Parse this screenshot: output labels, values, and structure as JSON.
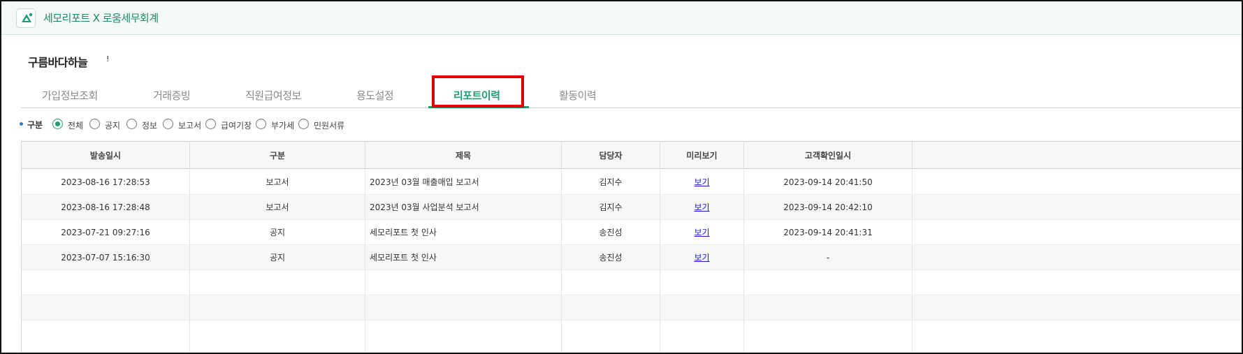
{
  "app": {
    "title": "세모리포트 X 로움세무회계",
    "logo_icon": "semo-logo-icon",
    "accent_color": "#1e9c76"
  },
  "company": {
    "name": "구름바다하늘",
    "mark": "!"
  },
  "tabs": [
    {
      "label": "가입정보조회",
      "active": false
    },
    {
      "label": "거래증빙",
      "active": false
    },
    {
      "label": "직원급여정보",
      "active": false
    },
    {
      "label": "용도설정",
      "active": false
    },
    {
      "label": "리포트이력",
      "active": true
    },
    {
      "label": "활동이력",
      "active": false
    }
  ],
  "filter": {
    "label": "구분",
    "options": [
      {
        "label": "전체",
        "selected": true
      },
      {
        "label": "공지",
        "selected": false
      },
      {
        "label": "정보",
        "selected": false
      },
      {
        "label": "보고서",
        "selected": false
      },
      {
        "label": "급여기장",
        "selected": false
      },
      {
        "label": "부가세",
        "selected": false
      },
      {
        "label": "민원서류",
        "selected": false
      }
    ]
  },
  "table": {
    "columns": [
      "발송일시",
      "구분",
      "제목",
      "담당자",
      "미리보기",
      "고객확인일시",
      ""
    ],
    "rows": [
      {
        "sent": "2023-08-16 17:28:53",
        "category": "보고서",
        "title": "2023년 03월 매출매입 보고서",
        "manager": "김지수",
        "preview": "보기",
        "confirmed": "2023-09-14 20:41:50"
      },
      {
        "sent": "2023-08-16 17:28:48",
        "category": "보고서",
        "title": "2023년 03월 사업분석 보고서",
        "manager": "김지수",
        "preview": "보기",
        "confirmed": "2023-09-14 20:42:10"
      },
      {
        "sent": "2023-07-21 09:27:16",
        "category": "공지",
        "title": "세모리포트 첫 인사",
        "manager": "송진성",
        "preview": "보기",
        "confirmed": "2023-09-14 20:41:31"
      },
      {
        "sent": "2023-07-07 15:16:30",
        "category": "공지",
        "title": "세모리포트 첫 인사",
        "manager": "송진성",
        "preview": "보기",
        "confirmed": "-"
      }
    ]
  }
}
